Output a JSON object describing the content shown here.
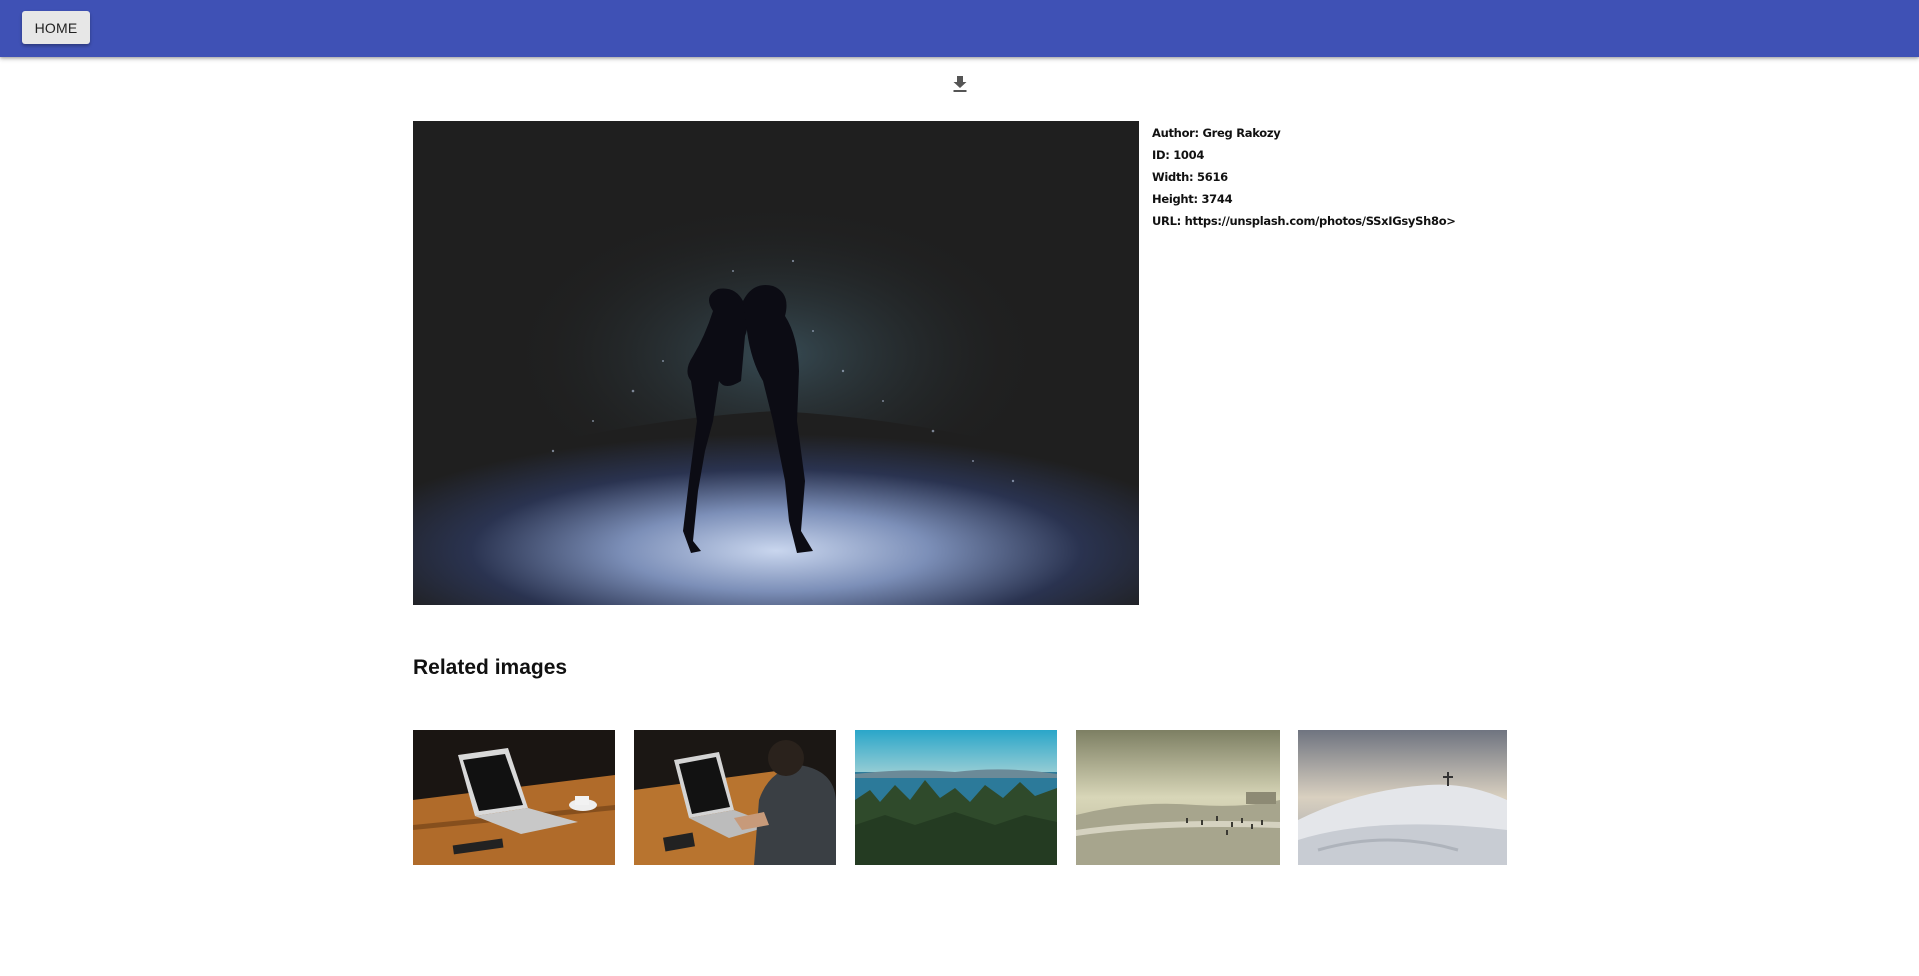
{
  "appbar": {
    "home_label": "HOME",
    "color": "#3f51b5"
  },
  "download": {
    "icon": "download-icon"
  },
  "photo": {
    "author": "Author: Greg Rakozy",
    "id": "ID: 1004",
    "width": "Width: 5616",
    "height": "Height: 3744",
    "url": "URL: https://unsplash.com/photos/SSxIGsySh8o>"
  },
  "related": {
    "heading": "Related images",
    "items": [
      {
        "subject": "laptop on wooden table"
      },
      {
        "subject": "person typing on laptop"
      },
      {
        "subject": "forest and sea"
      },
      {
        "subject": "beach with people"
      },
      {
        "subject": "snowy mountain"
      }
    ]
  }
}
